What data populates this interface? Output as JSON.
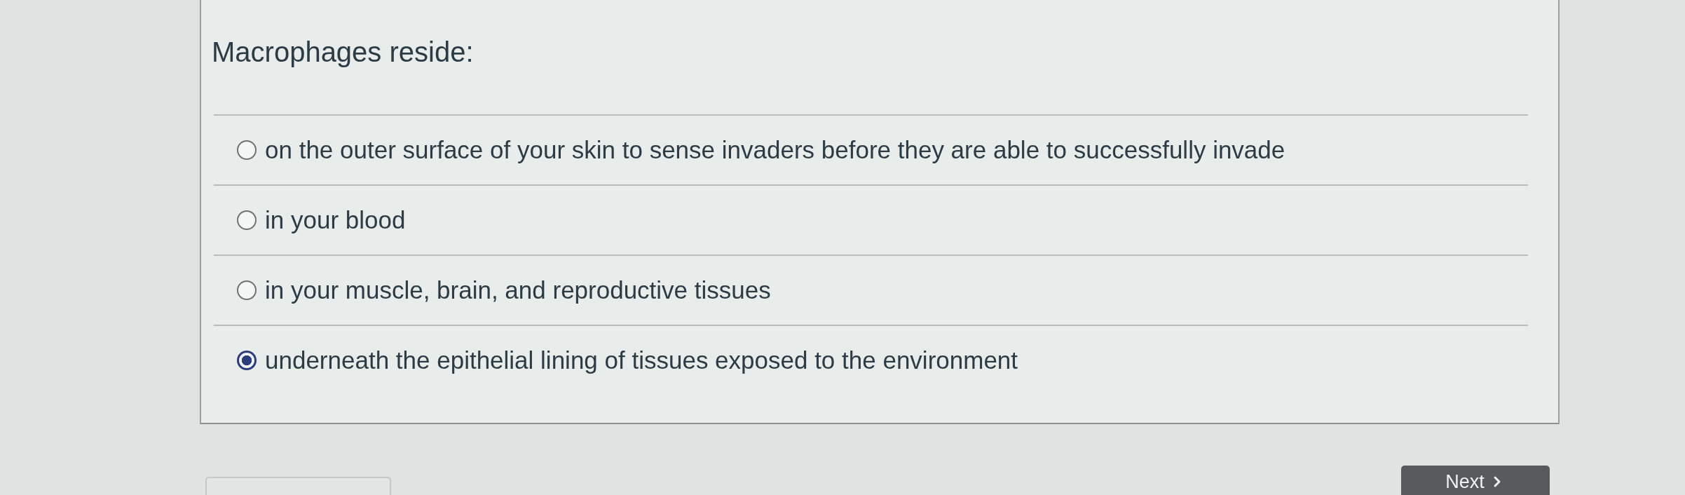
{
  "question": {
    "prompt": "Macrophages reside:",
    "options": [
      {
        "label": "on the outer surface of your skin to sense invaders before they are able to successfully invade",
        "selected": false
      },
      {
        "label": "in your blood",
        "selected": false
      },
      {
        "label": "in your muscle, brain, and reproductive tissues",
        "selected": false
      },
      {
        "label": "underneath the epithelial lining of tissues exposed to the environment",
        "selected": true
      }
    ]
  },
  "navigation": {
    "next_button": {
      "label": "Next"
    }
  }
}
